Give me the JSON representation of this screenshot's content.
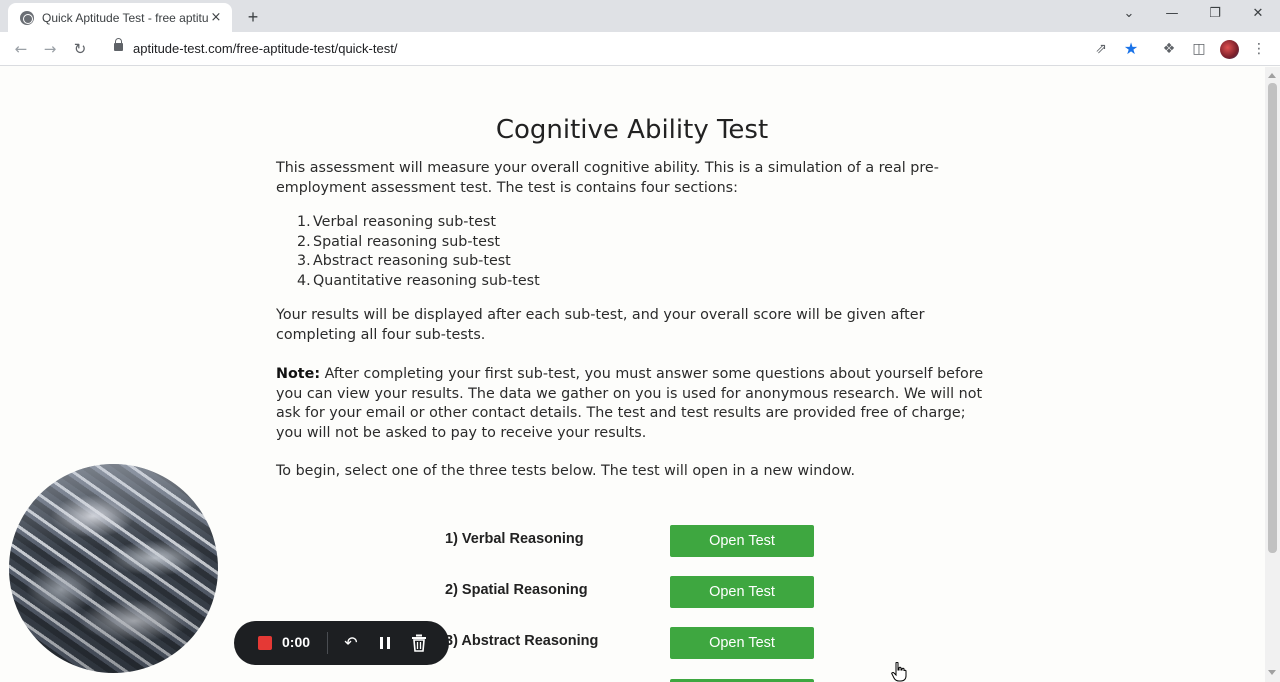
{
  "browser": {
    "tab_title": "Quick Aptitude Test - free aptitude",
    "tab_close": "×",
    "new_tab": "+",
    "url": "aptitude-test.com/free-aptitude-test/quick-test/",
    "window_controls": {
      "minimize": "—",
      "restore": "❐",
      "close": "✕",
      "dropdown": "⌄"
    }
  },
  "page": {
    "title": "Cognitive Ability Test",
    "intro": "This assessment will measure your overall cognitive ability. This is a simulation of a real pre-employment assessment test. The test is contains four sections:",
    "sections": [
      {
        "num": "1.",
        "label": "Verbal reasoning sub-test"
      },
      {
        "num": "2.",
        "label": "Spatial reasoning sub-test"
      },
      {
        "num": "3.",
        "label": "Abstract reasoning sub-test"
      },
      {
        "num": "4.",
        "label": "Quantitative reasoning sub-test"
      }
    ],
    "results_text": "Your results will be displayed after each sub-test, and your overall score will be given after completing all four sub-tests.",
    "note_label": "Note:",
    "note_text": " After completing your first sub-test, you must answer some questions about yourself before you can view your results. The data we gather on you is used for anonymous research. We will not ask for your email or other contact details. The test and test results are provided free of charge; you will not be asked to pay to receive your results.",
    "begin_text": "To begin, select one of the three tests below. The test will open in a new window.",
    "tests": [
      {
        "label": "1) Verbal Reasoning",
        "button": "Open Test"
      },
      {
        "label": "2) Spatial Reasoning",
        "button": "Open Test"
      },
      {
        "label": "3) Abstract Reasoning",
        "button": "Open Test"
      }
    ]
  },
  "recorder": {
    "time": "0:00",
    "colors": {
      "stop": "#e53935",
      "bar": "#1d1f22"
    }
  },
  "colors": {
    "open_button": "#3ea740",
    "star": "#1a73e8"
  }
}
